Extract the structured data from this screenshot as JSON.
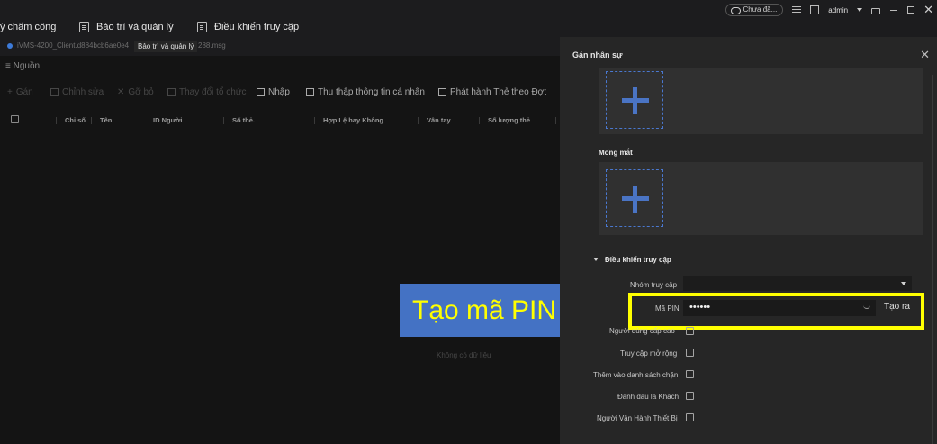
{
  "nav": {
    "item1": "ý chấm công",
    "item2": "Bảo trì và quản lý",
    "item3": "Điều khiển truy cập",
    "tooltip": "Bảo trì và quản lý"
  },
  "subline": {
    "client_file": "iVMS-4200_Client.d884bcb6ae0e4",
    "client_file_end": "288.msg"
  },
  "status": {
    "cloud": "Chưa đă...",
    "user": "admin"
  },
  "left": {
    "source": "Nguồn",
    "toolbar": {
      "add": "Gán",
      "edit": "Chỉnh sửa",
      "delete": "Gỡ bỏ",
      "change_org": "Thay đổi tổ chức",
      "import": "Nhập",
      "collect": "Thu thập thông tin cá nhân",
      "issue": "Phát hành Thẻ theo Đợt"
    },
    "columns": [
      "Chỉ số",
      "Tên",
      "ID Người",
      "Số thẻ.",
      "Hợp Lệ hay Không",
      "Vân tay",
      "Số lượng thẻ"
    ],
    "empty": "Không có dữ liệu"
  },
  "annotation": {
    "banner": "Tạo mã PIN"
  },
  "panel": {
    "title": "Gán nhân sự",
    "iris_label": "Mống mắt",
    "access_section": "Điều khiển truy cập",
    "access_group_label": "Nhóm truy cập",
    "access_group_value": "",
    "pin_label": "Mã PIN",
    "pin_value": "••••••",
    "generate": "Tạo ra",
    "checkboxes": [
      "Người dùng cấp cao",
      "Truy cập mở rộng",
      "Thêm vào danh sách chặn",
      "Đánh dấu là Khách",
      "Người Vận Hành Thiết Bị"
    ]
  },
  "colors": {
    "accent": "#4a74c4",
    "highlight": "#ffff00",
    "banner_bg": "#4472c4"
  }
}
